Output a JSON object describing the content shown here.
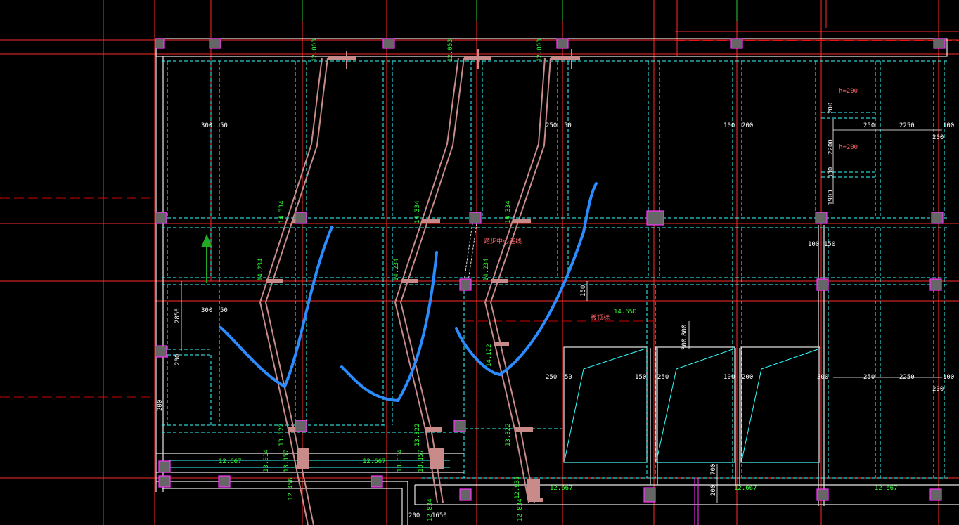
{
  "colors": {
    "background": "#000000",
    "axis": "#ff2a2a",
    "axis_dash": "#cc0000",
    "beam_dash": "#33ffff",
    "wall": "#e8e8e8",
    "stair": "#c98a8a",
    "column": "#ff33ff",
    "dimension": "#ffffff",
    "elevation": "#33ff33",
    "annotation": "#ff6666",
    "markup": "#2a8cff",
    "north_arrow": "#22aa22"
  },
  "icons": [
    "north-arrow-icon"
  ],
  "dims": {
    "d300a": "300",
    "d50a": "50",
    "d250a": "250",
    "d50b": "50",
    "d100a": "100",
    "d200a": "200",
    "d250b": "250",
    "d2250a": "2250",
    "d100b": "100",
    "d200b": "200",
    "d200v1": "200",
    "d2200": "2200",
    "d300v1": "300",
    "d1900": "1900",
    "d100c": "100",
    "d150a": "150",
    "d300b": "300",
    "d50c": "50",
    "d2850": "2850",
    "d200v2": "200",
    "d200v3": "200",
    "d150v": "150",
    "d800": "800",
    "d300v2": "300",
    "d250c": "250",
    "d50d": "50",
    "d150b": "150",
    "d250d": "250",
    "d100d": "100",
    "d200c": "200",
    "d300c": "300",
    "d250e": "250",
    "d2250b": "2250",
    "d100e": "100",
    "d200d": "200",
    "d700": "700",
    "d200v4": "200",
    "d200e": "200",
    "d1650": "1650"
  },
  "elevations": {
    "e12003a": "12.003",
    "e12003b": "12.003",
    "e12003c": "12.003",
    "e14334a": "14.334",
    "e14334b": "14.334",
    "e14334c": "14.334",
    "e14234a": "14.234",
    "e14234b": "14.234",
    "e14234c": "14.234",
    "e14650": "14.650",
    "e13322a": "13.322",
    "e13322b": "13.322",
    "e13322c": "13.322",
    "e12667a": "12.667",
    "e12667b": "12.667",
    "e12667c": "12.667",
    "e12667d": "12.667",
    "e12667e": "12.667",
    "e13014a": "13.014",
    "e13014b": "13.014",
    "e13157a": "13.157",
    "e13157b": "13.157",
    "e12456": "12.456",
    "e12834a": "12.834",
    "e12834b": "12.834",
    "e12935": "12.935",
    "e14122": "14.122"
  },
  "notes": {
    "h200a": "h=200",
    "h200b": "h=200",
    "stair_note": "踏步中心连线",
    "slab_note": "板顶标"
  }
}
